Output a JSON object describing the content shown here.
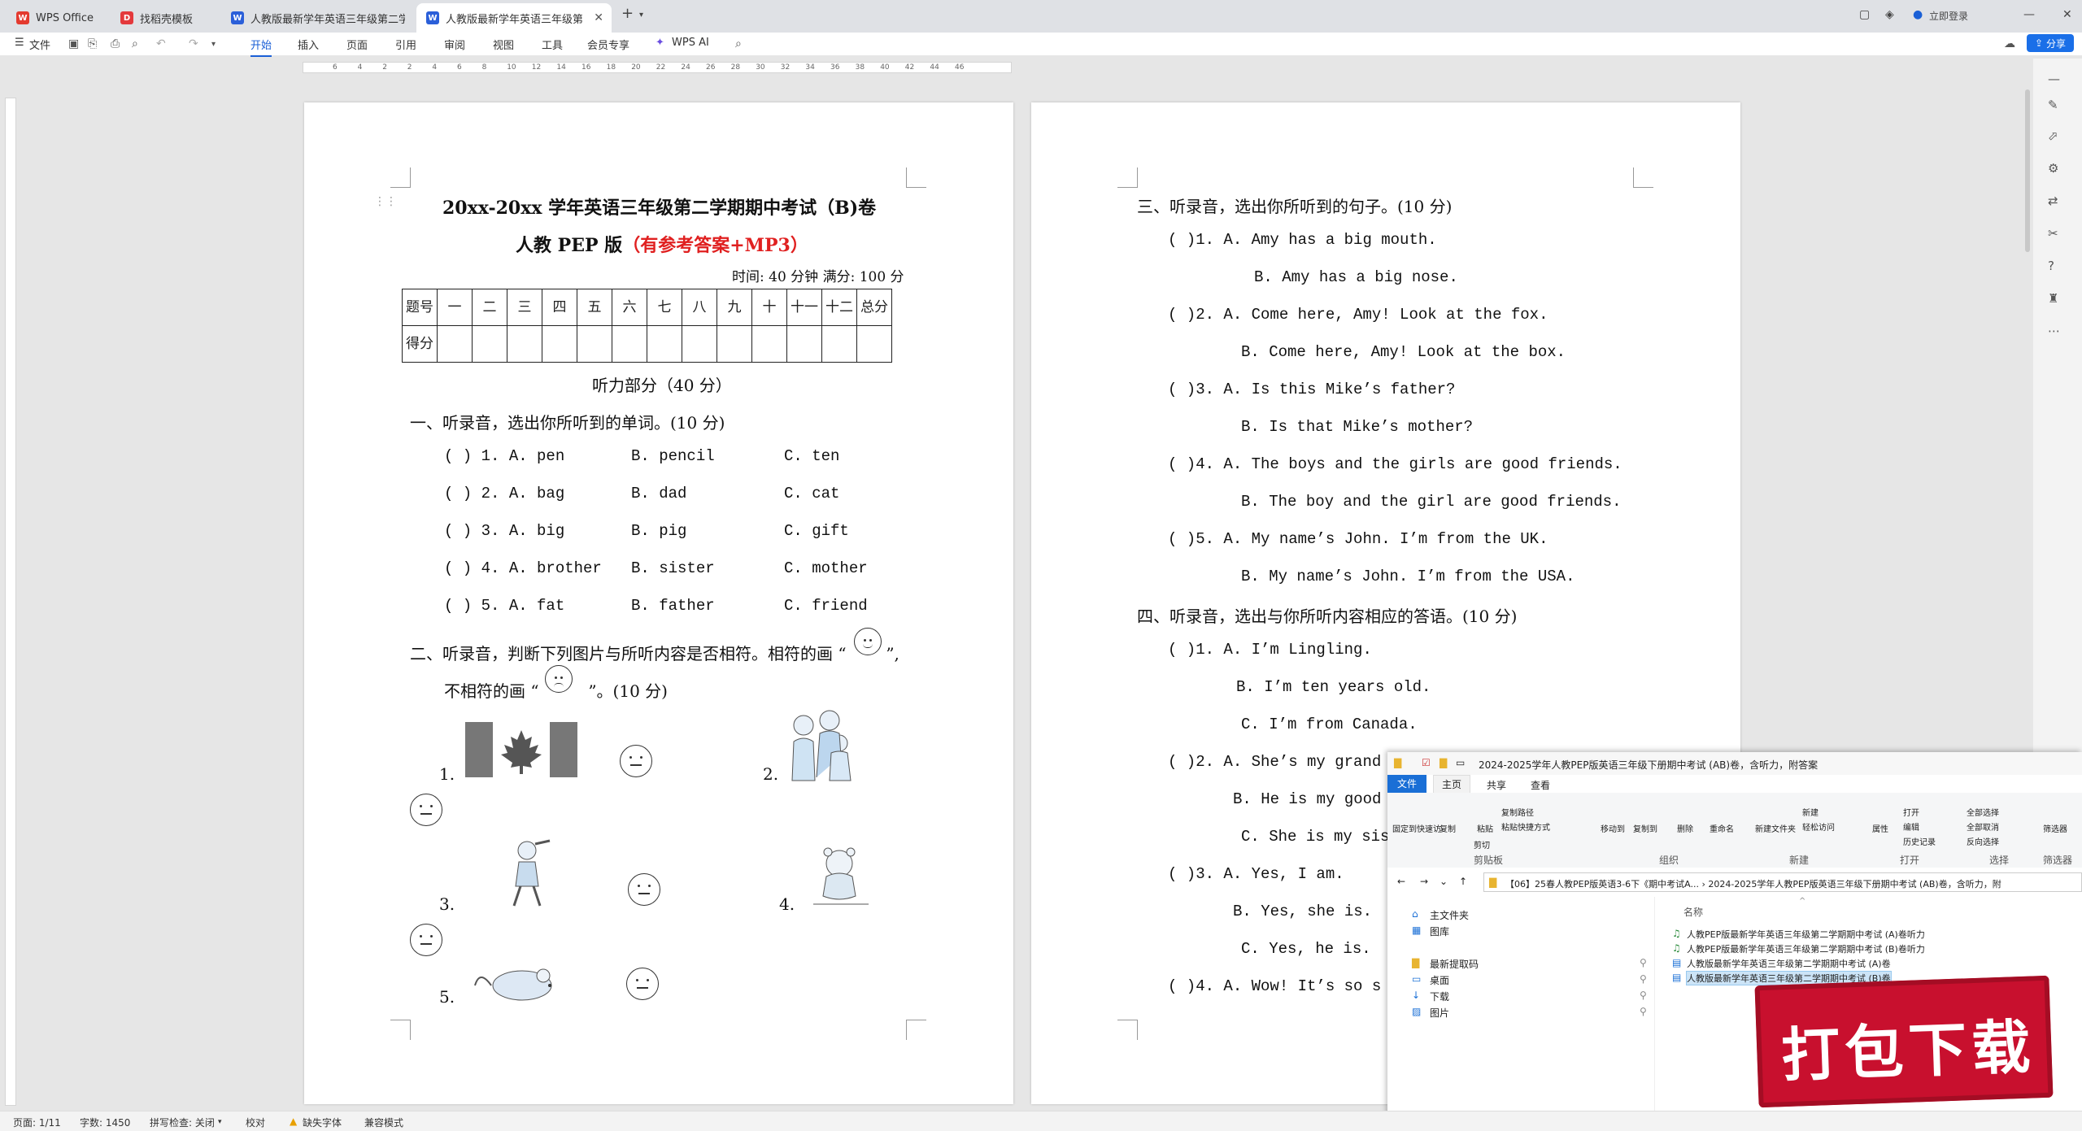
{
  "tabs": [
    {
      "label": "WPS Office",
      "icon": "wps-logo-icon"
    },
    {
      "label": "找稻壳模板",
      "icon": "docer-icon"
    },
    {
      "label": "人教版最新学年英语三年级第二学期",
      "icon": "word-doc-icon"
    },
    {
      "label": "人教版最新学年英语三年级第",
      "icon": "word-doc-icon"
    }
  ],
  "titlebar": {
    "login": "立即登录"
  },
  "ribbon": {
    "file": "文件",
    "menus": [
      "开始",
      "插入",
      "页面",
      "引用",
      "审阅",
      "视图",
      "工具",
      "会员专享",
      "WPS AI"
    ],
    "share": "分享"
  },
  "ruler_marks": [
    "6",
    "4",
    "2",
    "2",
    "4",
    "6",
    "8",
    "10",
    "12",
    "14",
    "16",
    "18",
    "20",
    "22",
    "24",
    "26",
    "28",
    "30",
    "32",
    "34",
    "36",
    "38",
    "40",
    "42",
    "44",
    "46"
  ],
  "page1": {
    "title": "20xx-20xx 学年英语三年级第二学期期中考试（B)卷",
    "subtitle_a": "人教 PEP 版",
    "subtitle_b": "（有参考答案+MP3）",
    "time_info": "时间: 40 分钟    满分: 100 分",
    "score_row1": [
      "题号",
      "一",
      "二",
      "三",
      "四",
      "五",
      "六",
      "七",
      "八",
      "九",
      "十",
      "十一",
      "十二",
      "总分"
    ],
    "score_row2_label": "得分",
    "section_header": "听力部分（40 分）",
    "q1_title": "一、听录音，选出你所听到的单词。(10 分)",
    "q1_items": [
      {
        "n": "(     ) 1.  A.  pen",
        "b": "B.  pencil",
        "c": "C.  ten"
      },
      {
        "n": "(     ) 2.  A.  bag",
        "b": "B.  dad",
        "c": "C.  cat"
      },
      {
        "n": "(     ) 3.  A.  big",
        "b": "B.  pig",
        "c": "C.  gift"
      },
      {
        "n": "(     ) 4.  A.  brother",
        "b": "B.  sister",
        "c": "C.  mother"
      },
      {
        "n": "(     ) 5.  A.  fat",
        "b": "B.  father",
        "c": "C.  friend"
      }
    ],
    "q2_title_a": "二、听录音，判断下列图片与所听内容是否相符。相符的画 “",
    "q2_title_b": "”,",
    "q2_line2_a": "不相符的画 “",
    "q2_line2_b": "”。(10 分)",
    "pic_nums": [
      "1.",
      "2.",
      "3.",
      "4.",
      "5."
    ]
  },
  "page2": {
    "q3_title": "三、听录音，选出你所听到的句子。(10 分)",
    "q3_lines": [
      "(      )1.  A.  Amy has a big mouth.",
      "B.  Amy has a big nose.",
      "(      )2.  A.  Come here, Amy! Look at the fox.",
      "B.  Come here, Amy! Look at the box.",
      "(      )3.  A.  Is this Mike’s father?",
      "B.  Is that Mike’s mother?",
      "(      )4.  A.  The boys and the girls are good friends.",
      "B.  The boy and the girl are good friends.",
      "(      )5.  A.  My name’s John. I’m from the UK.",
      "B.  My name’s John. I’m from the USA."
    ],
    "q4_title": "四、听录音，选出与你所听内容相应的答语。(10 分)",
    "q4_lines": [
      "(      )1.  A.  I’m Lingling.",
      "B.  I’m ten years old.",
      "C.  I’m from Canada.",
      "(      )2.  A.  She’s my grand",
      "B.  He is my good fr",
      "C.  She is my siste",
      "(      )3.  A.  Yes, I am.",
      "B.  Yes, she is.",
      "C.  Yes, he is.",
      "(      )4.  A.  Wow! It’s so s"
    ]
  },
  "explorer": {
    "title": "2024-2025学年人教PEP版英语三年级下册期中考试 (AB)卷，含听力，附答案",
    "tabs": [
      "文件",
      "主页",
      "共享",
      "查看"
    ],
    "buttons": [
      "固定到快速访问",
      "复制",
      "粘贴",
      "复制路径",
      "粘贴快捷方式",
      "剪切",
      "移动到",
      "复制到",
      "删除",
      "重命名",
      "新建文件夹",
      "新建",
      "轻松访问",
      "属性",
      "打开",
      "编辑",
      "历史记录",
      "全部选择",
      "全部取消",
      "反向选择",
      "筛选器"
    ],
    "groups": [
      "剪贴板",
      "组织",
      "新建",
      "打开",
      "选择",
      "筛选器"
    ],
    "address": "【06】25春人教PEP版英语3-6下《期中考试A...  ›  2024-2025学年人教PEP版英语三年级下册期中考试 (AB)卷，含听力，附",
    "nav": [
      "主文件夹",
      "图库",
      "最新提取码",
      "桌面",
      "下载",
      "图片"
    ],
    "col_name": "名称",
    "files": [
      "人教PEP版最新学年英语三年级第二学期期中考试 (A)卷听力",
      "人教PEP版最新学年英语三年级第二学期期中考试 (B)卷听力",
      "人教版最新学年英语三年级第二学期期中考试 (A)卷",
      "人教版最新学年英语三年级第二学期期中考试 (B)卷"
    ]
  },
  "stamp": "打包下载",
  "status": {
    "page": "页面: 1/11",
    "words": "字数: 1450",
    "spell": "拼写检查: 关闭",
    "proof": "校对",
    "missing_font": "缺失字体",
    "compat": "兼容模式"
  },
  "colors": {
    "accent": "#1a5fd6",
    "red_text": "#e02020",
    "stamp": "#c8102e"
  }
}
